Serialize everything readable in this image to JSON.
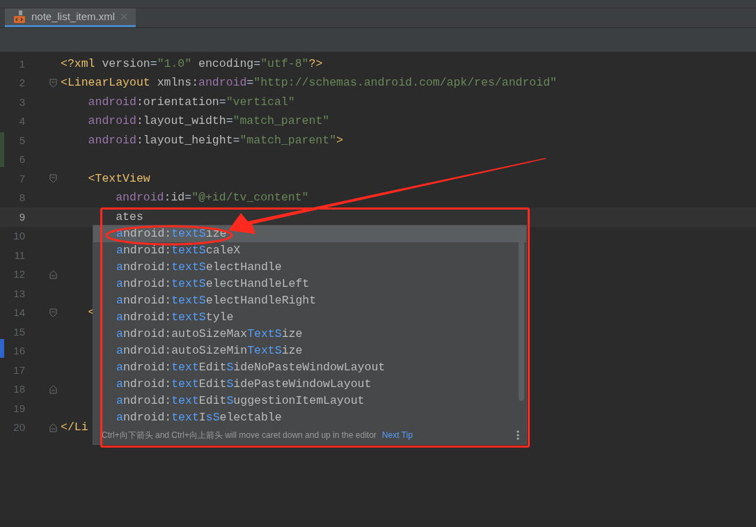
{
  "tab": {
    "label": "note_list_item.xml",
    "selected": true
  },
  "lines": [
    {
      "number": "1",
      "kind": "plain",
      "current": false,
      "tokens": [
        {
          "text": "<?xml ",
          "kind": "tag"
        },
        {
          "text": "version",
          "kind": "attr"
        },
        {
          "text": "=",
          "kind": "plain"
        },
        {
          "text": "\"1.0\"",
          "kind": "value"
        },
        {
          "text": " encoding",
          "kind": "attr"
        },
        {
          "text": "=",
          "kind": "plain"
        },
        {
          "text": "\"utf-8\"",
          "kind": "value"
        },
        {
          "text": "?>",
          "kind": "tag"
        }
      ]
    },
    {
      "number": "2",
      "kind": "fold-start",
      "current": false,
      "tokens": [
        {
          "text": "<LinearLayout ",
          "kind": "tag"
        },
        {
          "text": "xmlns:",
          "kind": "attr"
        },
        {
          "text": "android",
          "kind": "ns"
        },
        {
          "text": "=",
          "kind": "plain"
        },
        {
          "text": "\"http://schemas.android.com/apk/res/android\"",
          "kind": "value"
        }
      ]
    },
    {
      "number": "3",
      "kind": "plain",
      "current": false,
      "tokens": [
        {
          "text": "    android",
          "kind": "ns"
        },
        {
          "text": ":orientation",
          "kind": "attr"
        },
        {
          "text": "=",
          "kind": "plain"
        },
        {
          "text": "\"vertical\"",
          "kind": "value"
        }
      ]
    },
    {
      "number": "4",
      "kind": "plain",
      "current": false,
      "tokens": [
        {
          "text": "    android",
          "kind": "ns"
        },
        {
          "text": ":layout_width",
          "kind": "attr"
        },
        {
          "text": "=",
          "kind": "plain"
        },
        {
          "text": "\"match_parent\"",
          "kind": "value"
        }
      ]
    },
    {
      "number": "5",
      "kind": "plain",
      "current": false,
      "tokens": [
        {
          "text": "    android",
          "kind": "ns"
        },
        {
          "text": ":layout_height",
          "kind": "attr"
        },
        {
          "text": "=",
          "kind": "plain"
        },
        {
          "text": "\"match_parent\"",
          "kind": "value"
        },
        {
          "text": ">",
          "kind": "tag"
        }
      ]
    },
    {
      "number": "6",
      "kind": "plain",
      "current": false
    },
    {
      "number": "7",
      "kind": "fold-start",
      "current": false,
      "tokens": [
        {
          "text": "    <TextView",
          "kind": "tag"
        }
      ]
    },
    {
      "number": "8",
      "kind": "plain",
      "current": false,
      "tokens": [
        {
          "text": "        android",
          "kind": "ns"
        },
        {
          "text": ":id",
          "kind": "attr"
        },
        {
          "text": "=",
          "kind": "plain"
        },
        {
          "text": "\"@+id/tv_content\"",
          "kind": "value"
        }
      ]
    },
    {
      "number": "9",
      "kind": "plain",
      "current": true,
      "tokens": [
        {
          "text": "        ates",
          "kind": "attr"
        }
      ]
    },
    {
      "number": "10",
      "kind": "plain",
      "current": false
    },
    {
      "number": "11",
      "kind": "plain",
      "current": false
    },
    {
      "number": "12",
      "kind": "fold-end",
      "current": false
    },
    {
      "number": "13",
      "kind": "plain",
      "current": false
    },
    {
      "number": "14",
      "kind": "fold-start",
      "current": false,
      "tokens": [
        {
          "text": "    <",
          "kind": "tag"
        }
      ]
    },
    {
      "number": "15",
      "kind": "plain",
      "current": false
    },
    {
      "number": "16",
      "kind": "plain",
      "current": false
    },
    {
      "number": "17",
      "kind": "plain",
      "current": false
    },
    {
      "number": "18",
      "kind": "fold-end",
      "current": false
    },
    {
      "number": "19",
      "kind": "plain",
      "current": false
    },
    {
      "number": "20",
      "kind": "fold-end",
      "current": false,
      "tokens": [
        {
          "text": "</Li",
          "kind": "tag"
        }
      ]
    }
  ],
  "completion": {
    "items": [
      {
        "selected": true,
        "parts": [
          {
            "text": "a",
            "match": true
          },
          {
            "text": "ndroid:",
            "match": false
          },
          {
            "text": "text",
            "match": true
          },
          {
            "text": "S",
            "match": true
          },
          {
            "text": "ize",
            "match": false
          }
        ]
      },
      {
        "selected": false,
        "parts": [
          {
            "text": "a",
            "match": true
          },
          {
            "text": "ndroid:",
            "match": false
          },
          {
            "text": "text",
            "match": true
          },
          {
            "text": "S",
            "match": true
          },
          {
            "text": "caleX",
            "match": false
          }
        ]
      },
      {
        "selected": false,
        "parts": [
          {
            "text": "a",
            "match": true
          },
          {
            "text": "ndroid:",
            "match": false
          },
          {
            "text": "text",
            "match": true
          },
          {
            "text": "S",
            "match": true
          },
          {
            "text": "electHandle",
            "match": false
          }
        ]
      },
      {
        "selected": false,
        "parts": [
          {
            "text": "a",
            "match": true
          },
          {
            "text": "ndroid:",
            "match": false
          },
          {
            "text": "text",
            "match": true
          },
          {
            "text": "S",
            "match": true
          },
          {
            "text": "electHandleLeft",
            "match": false
          }
        ]
      },
      {
        "selected": false,
        "parts": [
          {
            "text": "a",
            "match": true
          },
          {
            "text": "ndroid:",
            "match": false
          },
          {
            "text": "text",
            "match": true
          },
          {
            "text": "S",
            "match": true
          },
          {
            "text": "electHandleRight",
            "match": false
          }
        ]
      },
      {
        "selected": false,
        "parts": [
          {
            "text": "a",
            "match": true
          },
          {
            "text": "ndroid:",
            "match": false
          },
          {
            "text": "text",
            "match": true
          },
          {
            "text": "S",
            "match": true
          },
          {
            "text": "tyle",
            "match": false
          }
        ]
      },
      {
        "selected": false,
        "parts": [
          {
            "text": "a",
            "match": true
          },
          {
            "text": "ndroid:autoSizeMax",
            "match": false
          },
          {
            "text": "Text",
            "match": true
          },
          {
            "text": "S",
            "match": true
          },
          {
            "text": "ize",
            "match": false
          }
        ]
      },
      {
        "selected": false,
        "parts": [
          {
            "text": "a",
            "match": true
          },
          {
            "text": "ndroid:autoSizeMin",
            "match": false
          },
          {
            "text": "Text",
            "match": true
          },
          {
            "text": "S",
            "match": true
          },
          {
            "text": "ize",
            "match": false
          }
        ]
      },
      {
        "selected": false,
        "parts": [
          {
            "text": "a",
            "match": true
          },
          {
            "text": "ndroid:",
            "match": false
          },
          {
            "text": "text",
            "match": true
          },
          {
            "text": "Edit",
            "match": false
          },
          {
            "text": "S",
            "match": true
          },
          {
            "text": "ideNoPasteWindowLayout",
            "match": false
          }
        ]
      },
      {
        "selected": false,
        "parts": [
          {
            "text": "a",
            "match": true
          },
          {
            "text": "ndroid:",
            "match": false
          },
          {
            "text": "text",
            "match": true
          },
          {
            "text": "Edit",
            "match": false
          },
          {
            "text": "S",
            "match": true
          },
          {
            "text": "idePasteWindowLayout",
            "match": false
          }
        ]
      },
      {
        "selected": false,
        "parts": [
          {
            "text": "a",
            "match": true
          },
          {
            "text": "ndroid:",
            "match": false
          },
          {
            "text": "text",
            "match": true
          },
          {
            "text": "Edit",
            "match": false
          },
          {
            "text": "S",
            "match": true
          },
          {
            "text": "uggestionItemLayout",
            "match": false
          }
        ]
      },
      {
        "selected": false,
        "parts": [
          {
            "text": "a",
            "match": true
          },
          {
            "text": "ndroid:",
            "match": false
          },
          {
            "text": "text",
            "match": true
          },
          {
            "text": "I",
            "match": false
          },
          {
            "text": "sS",
            "match": true
          },
          {
            "text": "electable",
            "match": false
          }
        ]
      }
    ],
    "hint": "Ctrl+向下箭头 and Ctrl+向上箭头 will move caret down and up in the editor",
    "link": "Next Tip"
  }
}
